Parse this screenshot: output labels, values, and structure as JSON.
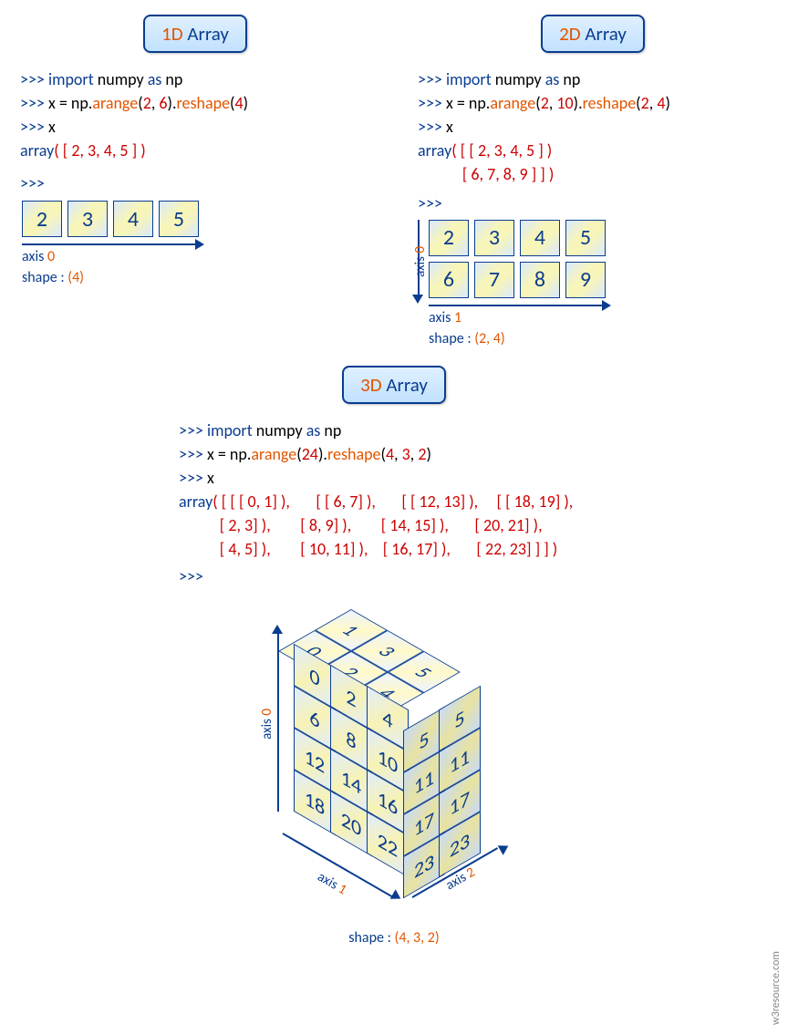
{
  "sec1d": {
    "title_prefix": "1D",
    "title_word": " Array",
    "code": {
      "l1a": "import",
      "l1b": " numpy ",
      "l1c": "as",
      "l1d": " np",
      "l2a": "x =  np.",
      "l2b": "arange",
      "l2c": "(",
      "l2d": "2",
      "l2e": ", ",
      "l2f": "6",
      "l2g": ").",
      "l2h": "reshape",
      "l2i": "(",
      "l2j": "4",
      "l2k": ")",
      "l3": "x",
      "out1": "array",
      "out2": "( [ 2, 3, 4, 5 ] )"
    },
    "cells": [
      "2",
      "3",
      "4",
      "5"
    ],
    "axis_label_a": "axis ",
    "axis_label_b": "0",
    "shape_a": "shape : ",
    "shape_b": "(4)"
  },
  "sec2d": {
    "title_prefix": "2D",
    "title_word": " Array",
    "code": {
      "l1a": "import",
      "l1b": " numpy ",
      "l1c": "as",
      "l1d": " np",
      "l2a": "x =  np.",
      "l2b": "arange",
      "l2c": "(",
      "l2d": "2",
      "l2e": ", ",
      "l2f": "10",
      "l2g": ").",
      "l2h": "reshape",
      "l2i": "(",
      "l2j": "2",
      "l2k": ", ",
      "l2l": "4",
      "l2m": ")",
      "l3": "x",
      "out1": "array",
      "out2": "( [ [ 2, 3, 4, 5 ] )",
      "out3": "            [ 6, 7, 8, 9 ] ] )"
    },
    "cells": [
      [
        "2",
        "3",
        "4",
        "5"
      ],
      [
        "6",
        "7",
        "8",
        "9"
      ]
    ],
    "axis0_a": "axis ",
    "axis0_b": "0",
    "axis1_a": "axis ",
    "axis1_b": "1",
    "shape_a": "shape : ",
    "shape_b": "(2, 4)"
  },
  "sec3d": {
    "title_prefix": "3D",
    "title_word": " Array",
    "code": {
      "l1a": "import",
      "l1b": " numpy ",
      "l1c": "as",
      "l1d": " np",
      "l2a": "x =  np.",
      "l2b": "arange",
      "l2c": "(",
      "l2d": "24",
      "l2e": ").",
      "l2f": "reshape",
      "l2g": "(",
      "l2h": "4",
      "l2i": ", ",
      "l2j": "3",
      "l2k": ", ",
      "l2l": "2",
      "l2m": ")",
      "l3": "x",
      "out_kw": "array",
      "out_rows": [
        "( [ [ [ 0, 1] ),       [ [ 6, 7] ),       [ [ 12, 13] ),     [ [ 18, 19] ),",
        "           [ 2, 3] ),        [ 8, 9] ),        [ 14, 15] ),       [ 20, 21] ),",
        "           [ 4, 5] ),        [ 10, 11] ),    [ 16, 17] ),       [ 22, 23] ] ] )"
      ]
    },
    "front": [
      [
        " 0",
        " 2",
        " 4"
      ],
      [
        " 6",
        " 8",
        "10"
      ],
      [
        "12",
        "14",
        "16"
      ],
      [
        "18",
        "20",
        "22"
      ]
    ],
    "side": [
      [
        " 5",
        " 5"
      ],
      [
        "11",
        "11"
      ],
      [
        "17",
        "17"
      ],
      [
        "23",
        "23"
      ]
    ],
    "top": [
      [
        " 0",
        " 1"
      ],
      [
        " 2",
        " 3"
      ],
      [
        " 4",
        " 5"
      ]
    ],
    "side_col": [
      " 5",
      "11",
      "17",
      "23"
    ],
    "top_front": [
      " 1",
      " 3",
      " 5"
    ],
    "axis0_a": "axis ",
    "axis0_b": "0",
    "axis1_a": "axis ",
    "axis1_b": "1",
    "axis2_a": "axis ",
    "axis2_b": "2",
    "shape_a": "shape : ",
    "shape_b": "(4, 3, 2)"
  },
  "credit": "w3resource.com"
}
